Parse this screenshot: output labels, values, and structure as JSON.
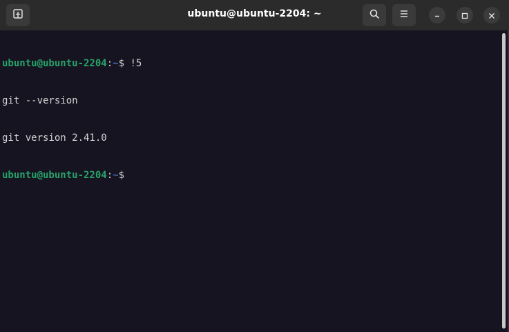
{
  "window": {
    "title": "ubuntu@ubuntu-2204: ~"
  },
  "titlebar": {
    "icons": {
      "new_tab": "new-tab-icon",
      "search": "search-icon",
      "menu": "hamburger-menu-icon",
      "minimize": "minimize-icon",
      "maximize": "maximize-icon",
      "close": "close-icon"
    }
  },
  "terminal": {
    "lines": [
      {
        "user": "ubuntu@ubuntu-2204",
        "sep": ":",
        "path": "~",
        "prompt": "$ ",
        "command": "!5"
      },
      {
        "output": "git --version"
      },
      {
        "output": "git version 2.41.0"
      },
      {
        "user": "ubuntu@ubuntu-2204",
        "sep": ":",
        "path": "~",
        "prompt": "$ ",
        "command": ""
      }
    ]
  },
  "colors": {
    "background": "#171421",
    "titlebar": "#2b2b2b",
    "prompt_user": "#26a269",
    "prompt_path": "#3f6dbf",
    "text": "#d3d3d3"
  }
}
